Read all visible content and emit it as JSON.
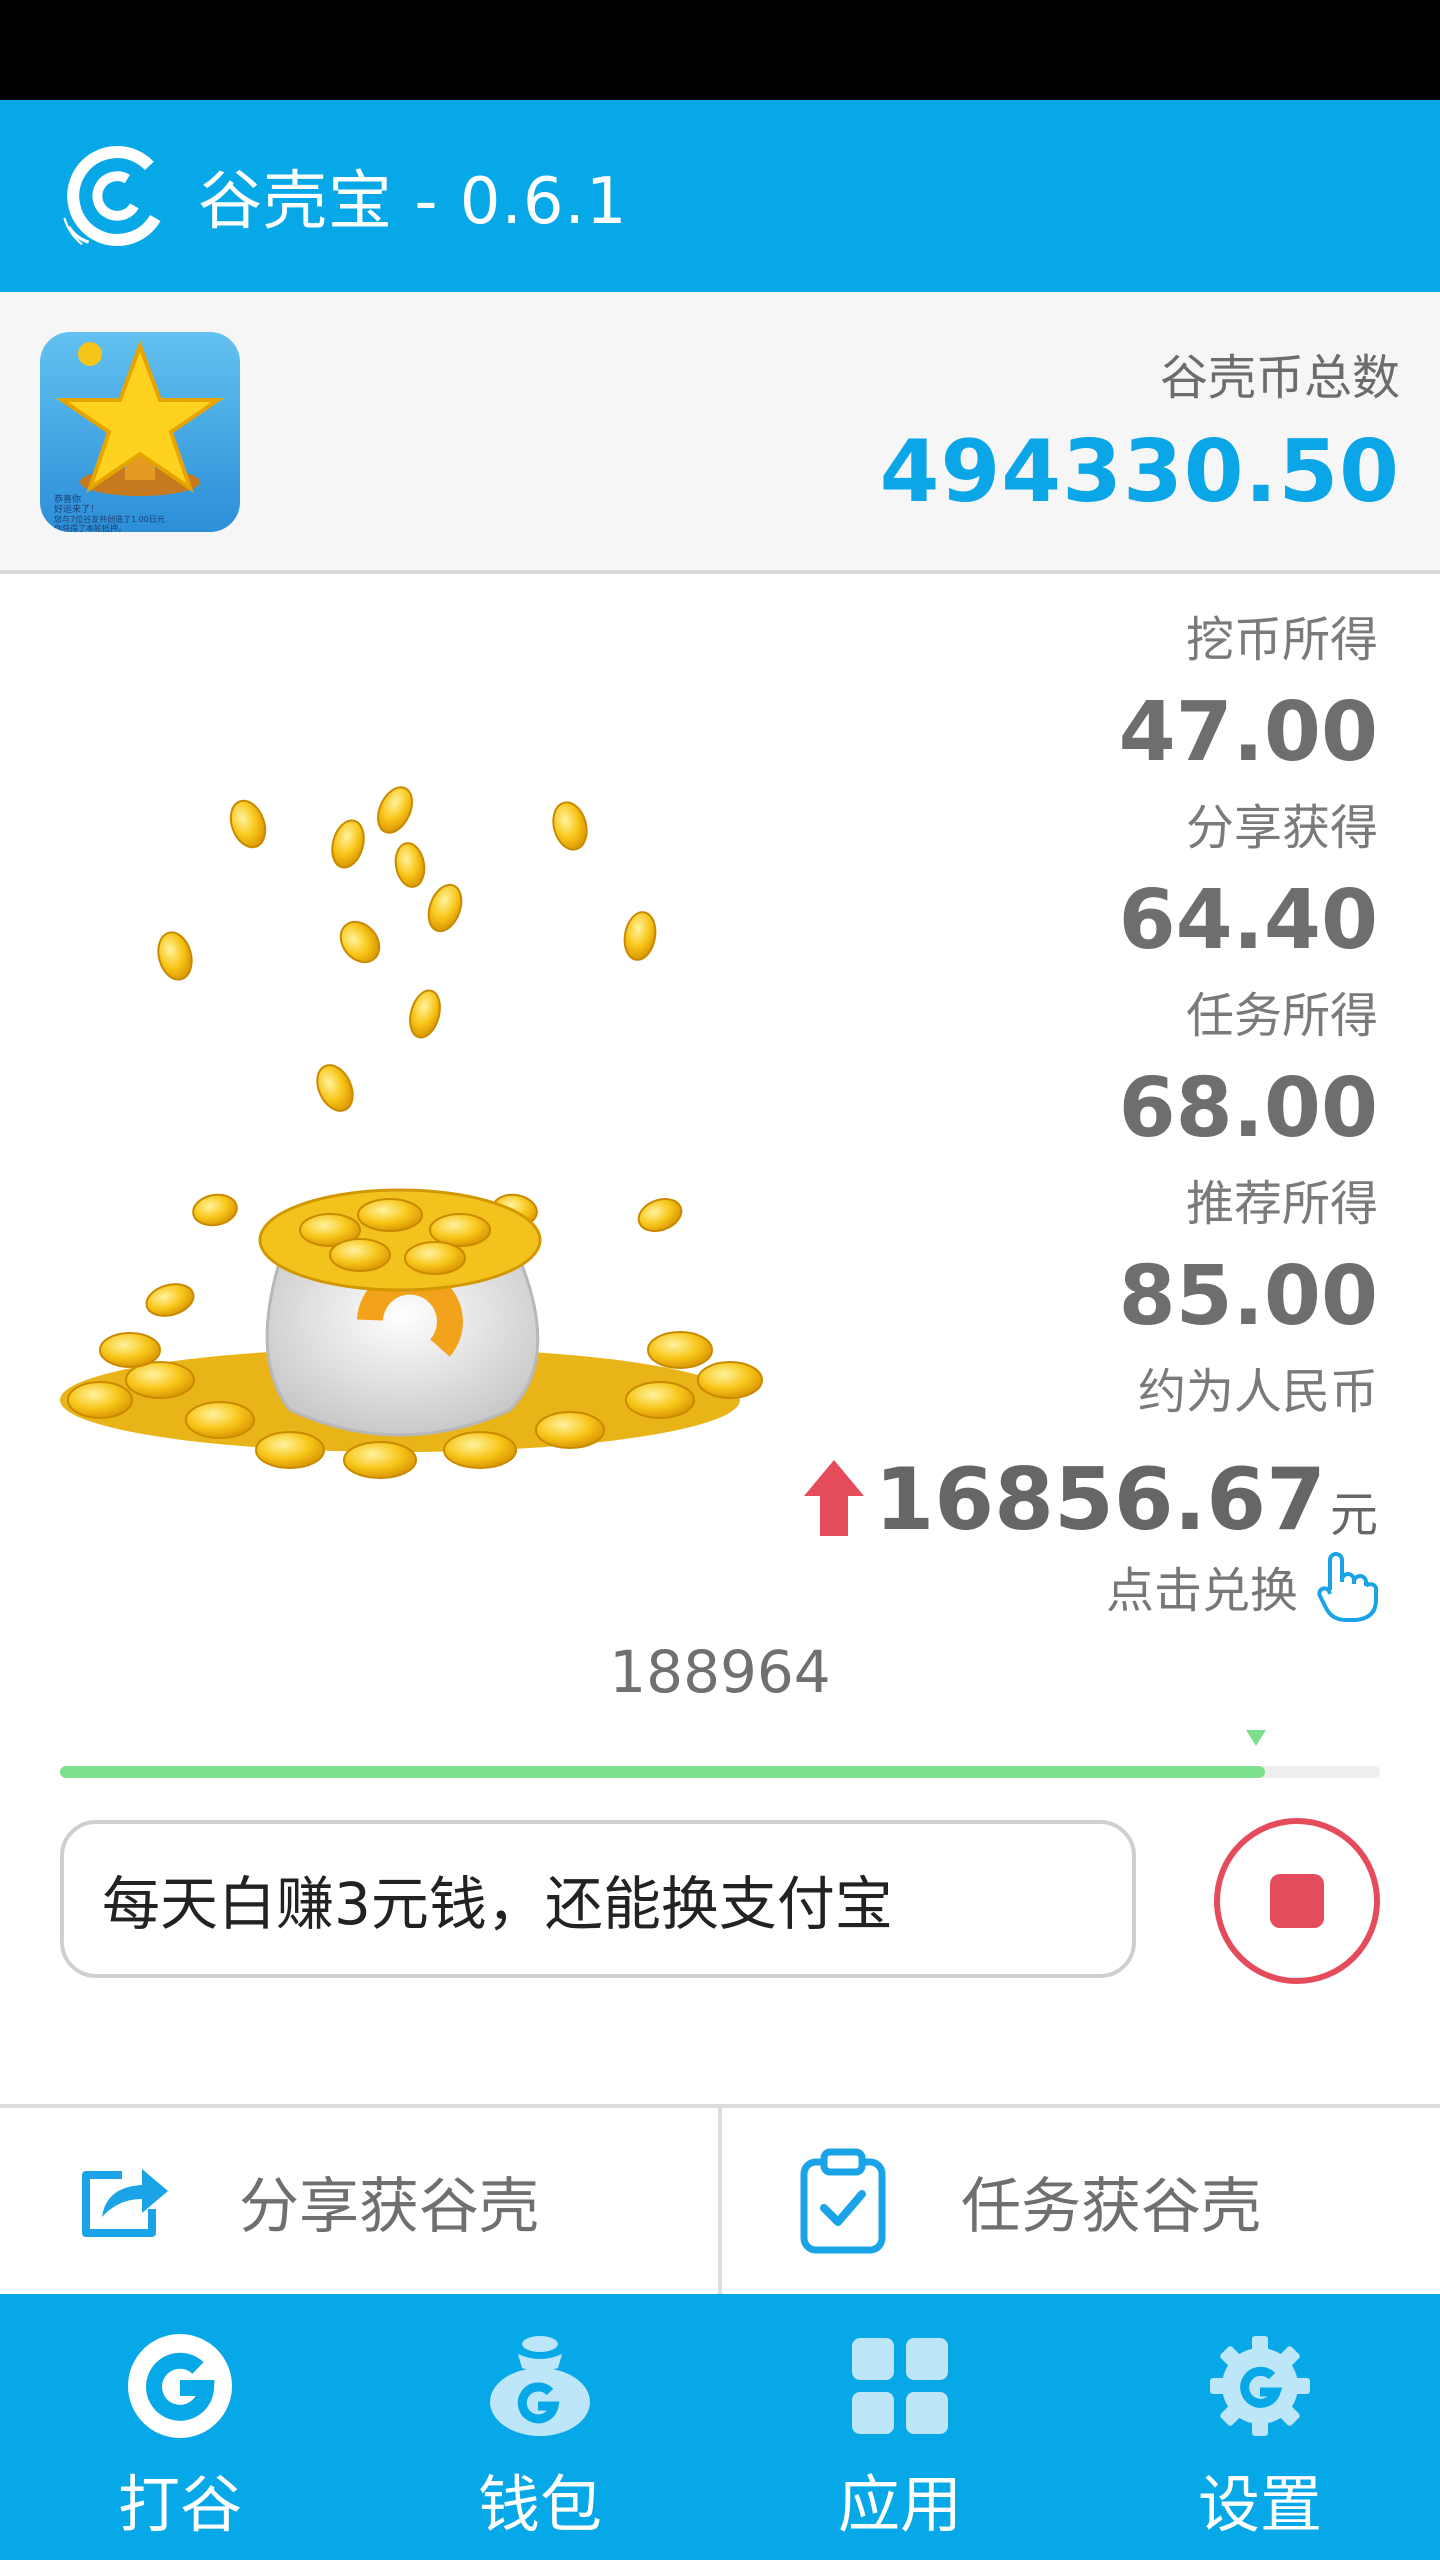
{
  "app": {
    "title": "谷壳宝 - 0.6.1"
  },
  "summary": {
    "label": "谷壳币总数",
    "total": "494330.50",
    "icon_text": [
      "恭喜你",
      "好运来了！",
      "您与7位谷友共创造了1.00日元",
      "你获得了本轮抵押。"
    ]
  },
  "stats": [
    {
      "label": "挖币所得",
      "value": "47.00"
    },
    {
      "label": "分享获得",
      "value": "64.40"
    },
    {
      "label": "任务所得",
      "value": "68.00"
    },
    {
      "label": "推荐所得",
      "value": "85.00"
    }
  ],
  "rmb": {
    "label": "约为人民币",
    "value": "16856.67",
    "unit": "元",
    "trend_icon": "up-arrow-icon"
  },
  "exchange": {
    "label": "点击兑换",
    "icon": "hand-pointer-icon"
  },
  "counter": "188964",
  "progress": {
    "fraction": 0.913,
    "color": "#7ee08e"
  },
  "message": "每天白赚3元钱，还能换支付宝",
  "stop_button": {
    "icon": "stop-icon",
    "color": "#e44c5c"
  },
  "actions": [
    {
      "label": "分享获谷壳",
      "icon": "share-icon"
    },
    {
      "label": "任务获谷壳",
      "icon": "clipboard-check-icon"
    }
  ],
  "nav": [
    {
      "label": "打谷",
      "icon": "logo-g-icon"
    },
    {
      "label": "钱包",
      "icon": "wallet-bag-icon"
    },
    {
      "label": "应用",
      "icon": "apps-grid-icon"
    },
    {
      "label": "设置",
      "icon": "gear-icon"
    }
  ],
  "colors": {
    "brand": "#06a8e8",
    "accent": "#0aa6e8",
    "alert": "#e44c5c"
  }
}
